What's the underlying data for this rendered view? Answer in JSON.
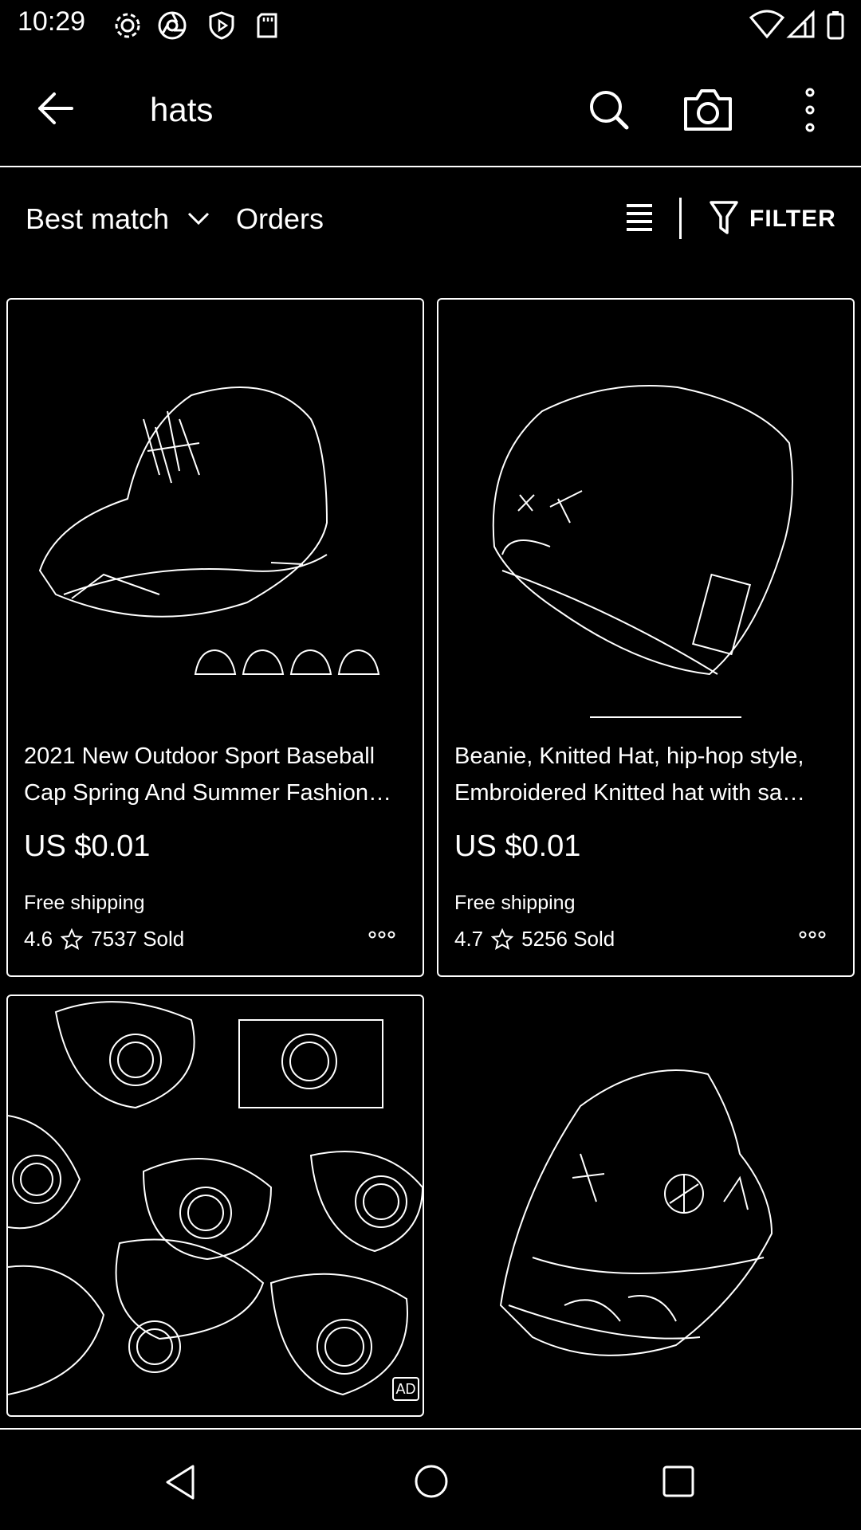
{
  "status_bar": {
    "time": "10:29",
    "left_icons": [
      "gear-icon",
      "chrome-icon",
      "shield-play-icon",
      "sd-card-icon"
    ],
    "right_icons": [
      "wifi-icon",
      "signal-icon",
      "battery-icon"
    ]
  },
  "search_header": {
    "query": "hats",
    "icons": [
      "back-arrow-icon",
      "search-icon",
      "camera-icon",
      "more-vertical-icon"
    ]
  },
  "sort_bar": {
    "sort_label": "Best match",
    "orders_label": "Orders",
    "filter_label": "FILTER"
  },
  "products": [
    {
      "title": "2021 New Outdoor Sport Baseball Cap Spring And Summer Fashion…",
      "price": "US $0.01",
      "shipping": "Free shipping",
      "rating": "4.6",
      "sold": "7537 Sold"
    },
    {
      "title": "Beanie, Knitted Hat, hip-hop style, Embroidered Knitted hat with sa…",
      "price": "US $0.01",
      "shipping": "Free shipping",
      "rating": "4.7",
      "sold": "5256 Sold"
    }
  ],
  "ad_badge": "AD",
  "nav_icons": [
    "nav-back-icon",
    "nav-home-icon",
    "nav-recents-icon"
  ]
}
